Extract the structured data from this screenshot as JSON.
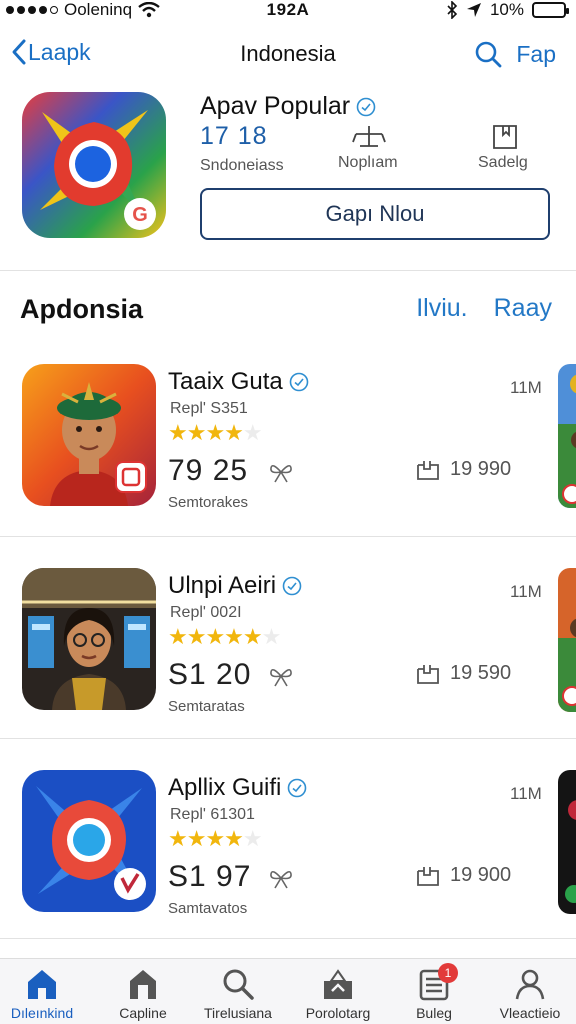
{
  "status_bar": {
    "carrier": "Ooleninq",
    "time": "192A",
    "battery": "10%",
    "battery_level": 0.1
  },
  "nav": {
    "back_label": "Laapk",
    "title": "Indonesia",
    "action_label": "Fap"
  },
  "featured": {
    "title": "Apav Popular",
    "stats": [
      {
        "value": "17 18",
        "label": "Sndoneiass"
      },
      {
        "value": "",
        "label": "Noplıam",
        "icon": "balance-icon"
      },
      {
        "value": "",
        "label": "Sadelg",
        "icon": "bookmark-icon"
      }
    ],
    "button_label": "Gapı Nlou",
    "accent": "#1e5fa8"
  },
  "section": {
    "title": "Apdonsia",
    "action_1": "Ilviu.",
    "action_2": "Raay"
  },
  "apps": [
    {
      "name": "Taaix Guta",
      "developer": "Repl' S351",
      "rating": 4,
      "price": "79 25",
      "sublabel": "Semtorakes",
      "size": "11M",
      "downloads": "19 990"
    },
    {
      "name": "Ulnpi Aeiri",
      "developer": "Repl' 002I",
      "rating": 5,
      "price": "S1 20",
      "sublabel": "Semtaratas",
      "size": "11M",
      "downloads": "19 590"
    },
    {
      "name": "Apllix Guifi",
      "developer": "Repl' 61301",
      "rating": 4,
      "price": "S1 97",
      "sublabel": "Samtavatos",
      "size": "11M",
      "downloads": "19 900"
    }
  ],
  "tabs": [
    {
      "label": "Dıleınkind",
      "icon": "home-icon",
      "active": true
    },
    {
      "label": "Capline",
      "icon": "house-icon"
    },
    {
      "label": "Tirelusiana",
      "icon": "search-icon"
    },
    {
      "label": "Porolotarg",
      "icon": "recycle-icon"
    },
    {
      "label": "Buleg",
      "icon": "list-icon",
      "badge": "1"
    },
    {
      "label": "Vleactieio",
      "icon": "person-icon"
    }
  ]
}
